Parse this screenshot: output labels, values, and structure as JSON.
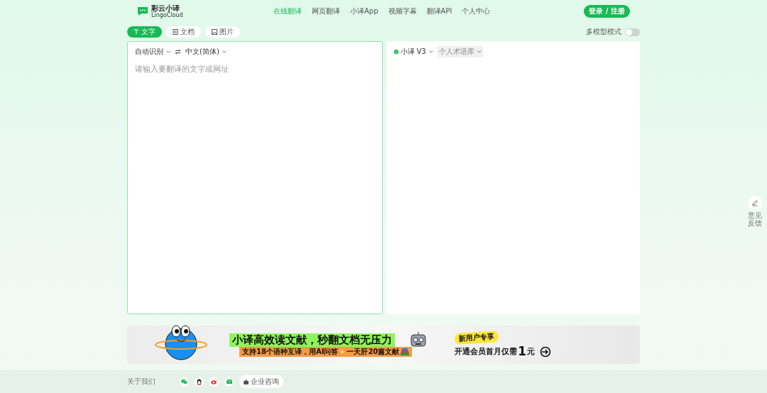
{
  "logo": {
    "name": "彩云小译",
    "subtitle": "LingoCloud"
  },
  "nav": [
    {
      "label": "在线翻译",
      "selected": true
    },
    {
      "label": "网页翻译",
      "selected": false
    },
    {
      "label": "小译App",
      "selected": false
    },
    {
      "label": "视频字幕",
      "selected": false
    },
    {
      "label": "翻译API",
      "selected": false
    },
    {
      "label": "个人中心",
      "selected": false
    }
  ],
  "login_button": "登录 / 注册",
  "mode_tabs": [
    {
      "label": "文字",
      "kind": "text",
      "selected": true
    },
    {
      "label": "文档",
      "kind": "doc",
      "selected": false
    },
    {
      "label": "图片",
      "kind": "image",
      "selected": false
    }
  ],
  "multi_model": {
    "label": "多模型模式",
    "on": false
  },
  "source": {
    "source_language": "自动识别",
    "target_language": "中文(简体)",
    "placeholder": "请输入要翻译的文字或网址"
  },
  "result": {
    "model": "小译 V3",
    "glossary": "个人术语库"
  },
  "feedback": "意见反馈",
  "banner": {
    "headline": "小译高效读文献，秒翻文档无压力",
    "subline": "支持18个语种互译，用AI问答",
    "subline_2": "一天肝20篇文献",
    "badge": "新用户专享",
    "offer": "开通会员首月仅需",
    "price": "1",
    "unit": "元"
  },
  "footer": {
    "about": "关于我们",
    "business": "企业咨询"
  }
}
